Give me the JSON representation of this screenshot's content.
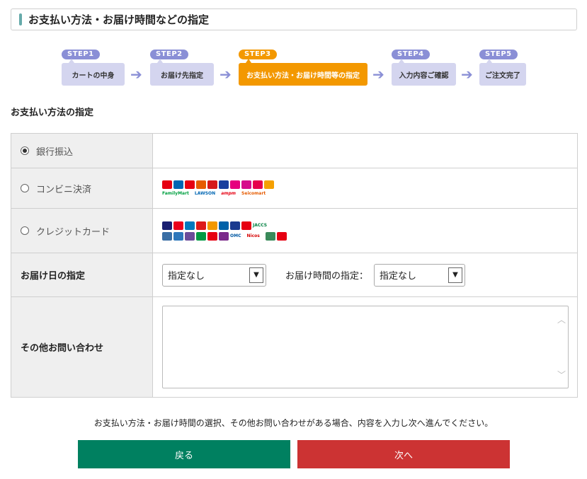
{
  "header": {
    "title": "お支払い方法・お届け時間などの指定"
  },
  "steps": [
    {
      "badge": "STEP1",
      "label": "カートの中身"
    },
    {
      "badge": "STEP2",
      "label": "お届け先指定"
    },
    {
      "badge": "STEP3",
      "label": "お支払い方法・お届け時間等の指定",
      "active": true
    },
    {
      "badge": "STEP4",
      "label": "入力内容ご確認"
    },
    {
      "badge": "STEP5",
      "label": "ご注文完了"
    }
  ],
  "arrow_glyph": "➔",
  "section": {
    "title": "お支払い方法の指定"
  },
  "payment": {
    "bank": "銀行振込",
    "convenience": "コンビニ決済",
    "credit": "クレジットカード",
    "selected": "bank",
    "convenience_logo_texts": [
      "FamilyMart",
      "LAWSON",
      "ampm",
      "Seicomart"
    ],
    "credit_logo_texts": [
      "JACCS",
      "OMC",
      "Nicos"
    ]
  },
  "delivery": {
    "date_label": "お届け日の指定",
    "date_value": "指定なし",
    "time_label": "お届け時間の指定：",
    "time_value": "指定なし"
  },
  "inquiry": {
    "label": "その他お問い合わせ",
    "value": ""
  },
  "note": "お支払い方法・お届け時間の選択、その他お問い合わせがある場合、内容を入力し次へ進んでください。",
  "buttons": {
    "back": "戻る",
    "next": "次へ"
  },
  "colors": {
    "step_badge": "#8a8fd6",
    "step_box": "#d4d5ef",
    "step_active": "#f39800",
    "back_button": "#008060",
    "next_button": "#cc3333"
  }
}
